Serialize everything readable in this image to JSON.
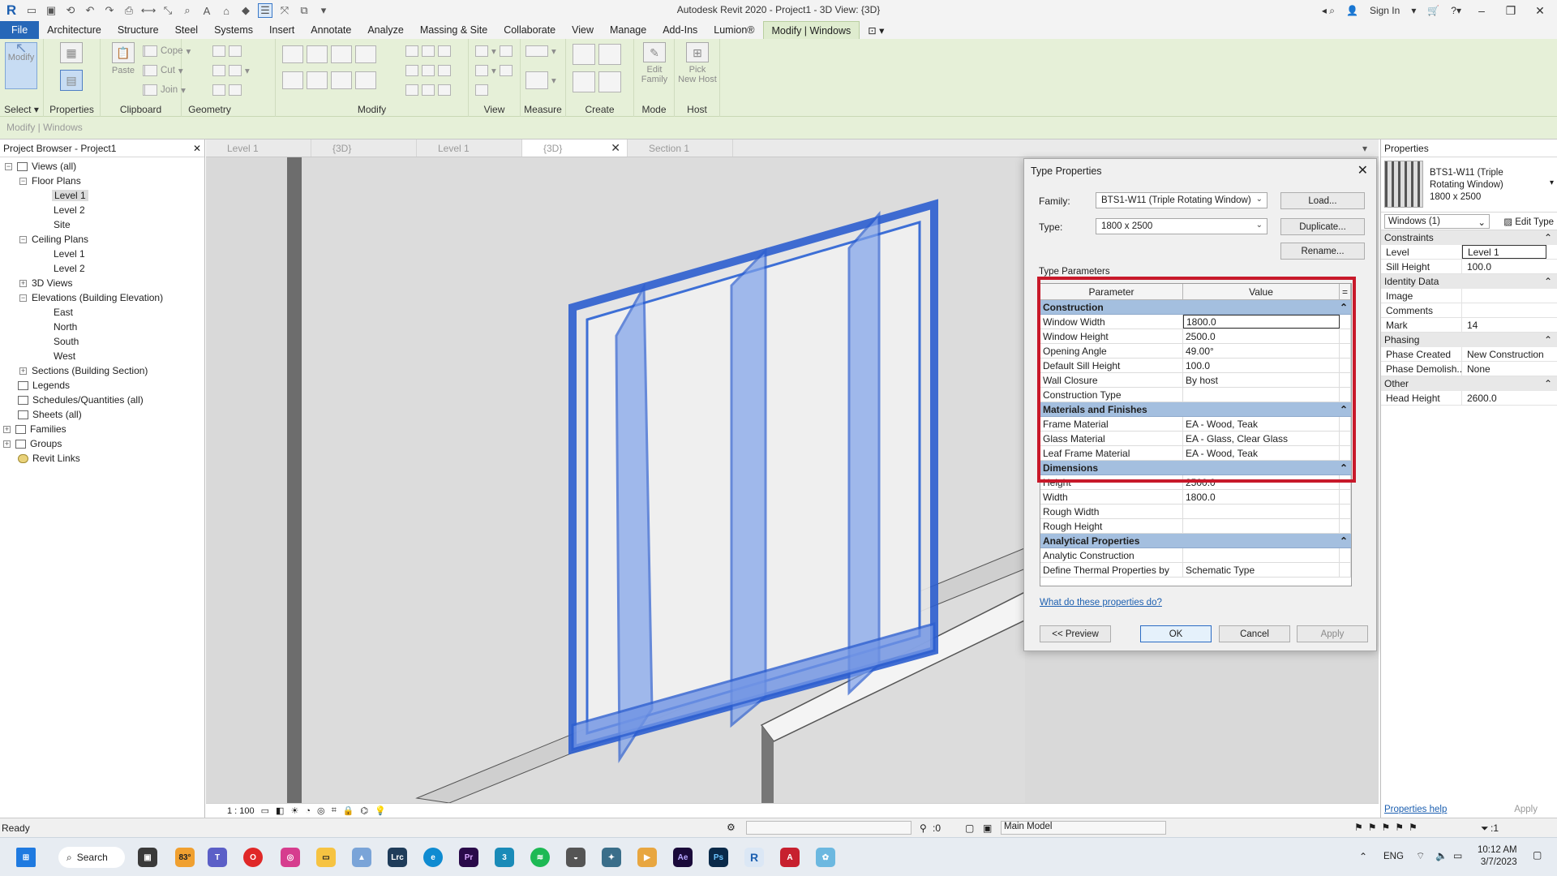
{
  "app": {
    "title": "Autodesk Revit 2020 - Project1 - 3D View: {3D}",
    "sign_in": "Sign In"
  },
  "ribbon": {
    "tabs": [
      "File",
      "Architecture",
      "Structure",
      "Steel",
      "Systems",
      "Insert",
      "Annotate",
      "Analyze",
      "Massing & Site",
      "Collaborate",
      "View",
      "Manage",
      "Add-Ins",
      "Lumion®",
      "Modify | Windows"
    ],
    "panels": {
      "select": "Select",
      "properties": "Properties",
      "clipboard": "Clipboard",
      "geometry": "Geometry",
      "modify": "Modify",
      "view": "View",
      "measure": "Measure",
      "create": "Create",
      "mode": "Mode",
      "host": "Host"
    },
    "buttons": {
      "modify": "Modify",
      "paste": "Paste",
      "cope": "Cope",
      "cut": "Cut",
      "join": "Join",
      "edit_family_1": "Edit",
      "edit_family_2": "Family",
      "pick_host_1": "Pick",
      "pick_host_2": "New Host"
    },
    "context": "Modify | Windows"
  },
  "project_browser": {
    "title": "Project Browser - Project1",
    "nodes": [
      {
        "label": "Views (all)"
      },
      {
        "label": "Floor Plans"
      },
      {
        "label": "Level 1"
      },
      {
        "label": "Level 2"
      },
      {
        "label": "Site"
      },
      {
        "label": "Ceiling Plans"
      },
      {
        "label": "Level 1"
      },
      {
        "label": "Level 2"
      },
      {
        "label": "3D Views"
      },
      {
        "label": "Elevations (Building Elevation)"
      },
      {
        "label": "East"
      },
      {
        "label": "North"
      },
      {
        "label": "South"
      },
      {
        "label": "West"
      },
      {
        "label": "Sections (Building Section)"
      },
      {
        "label": "Legends"
      },
      {
        "label": "Schedules/Quantities (all)"
      },
      {
        "label": "Sheets (all)"
      },
      {
        "label": "Families"
      },
      {
        "label": "Groups"
      },
      {
        "label": "Revit Links"
      }
    ]
  },
  "view_tabs": [
    "Level 1",
    "{3D}",
    "Level 1",
    "{3D}",
    "Section 1"
  ],
  "view_control": {
    "scale": "1 : 100"
  },
  "dialog": {
    "title": "Type Properties",
    "family_label": "Family:",
    "family_value": "BTS1-W11 (Triple Rotating Window)",
    "type_label": "Type:",
    "type_value": "1800 x 2500",
    "load": "Load...",
    "duplicate": "Duplicate...",
    "rename": "Rename...",
    "type_params_label": "Type Parameters",
    "col_param": "Parameter",
    "col_value": "Value",
    "col_eq": "=",
    "sections": [
      {
        "name": "Construction",
        "rows": [
          {
            "p": "Window Width",
            "v": "1800.0"
          },
          {
            "p": "Window Height",
            "v": "2500.0"
          },
          {
            "p": "Opening Angle",
            "v": "49.00°"
          },
          {
            "p": "Default Sill Height",
            "v": "100.0"
          },
          {
            "p": "Wall Closure",
            "v": "By host"
          },
          {
            "p": "Construction Type",
            "v": ""
          }
        ]
      },
      {
        "name": "Materials and Finishes",
        "rows": [
          {
            "p": "Frame Material",
            "v": "EA - Wood, Teak"
          },
          {
            "p": "Glass Material",
            "v": "EA - Glass, Clear Glass"
          },
          {
            "p": "Leaf Frame Material",
            "v": "EA - Wood, Teak"
          }
        ]
      },
      {
        "name": "Dimensions",
        "rows": [
          {
            "p": "Height",
            "v": "2500.0"
          },
          {
            "p": "Width",
            "v": "1800.0"
          },
          {
            "p": "Rough Width",
            "v": ""
          },
          {
            "p": "Rough Height",
            "v": ""
          }
        ]
      },
      {
        "name": "Analytical Properties",
        "rows": [
          {
            "p": "Analytic Construction",
            "v": ""
          },
          {
            "p": "Define Thermal Properties by",
            "v": "Schematic Type"
          }
        ]
      }
    ],
    "help_link": "What do these properties do?",
    "preview": "<< Preview",
    "ok": "OK",
    "cancel": "Cancel",
    "apply": "Apply"
  },
  "properties": {
    "title": "Properties",
    "type_name_1": "BTS1-W11 (Triple",
    "type_name_2": "Rotating Window)",
    "type_name_3": "1800 x 2500",
    "selector": "Windows (1)",
    "edit_type": "Edit Type",
    "sections": [
      {
        "name": "Constraints",
        "rows": [
          {
            "p": "Level",
            "v": "Level 1"
          },
          {
            "p": "Sill Height",
            "v": "100.0"
          }
        ]
      },
      {
        "name": "Identity Data",
        "rows": [
          {
            "p": "Image",
            "v": ""
          },
          {
            "p": "Comments",
            "v": ""
          },
          {
            "p": "Mark",
            "v": "14"
          }
        ]
      },
      {
        "name": "Phasing",
        "rows": [
          {
            "p": "Phase Created",
            "v": "New Construction"
          },
          {
            "p": "Phase Demolish...",
            "v": "None"
          }
        ]
      },
      {
        "name": "Other",
        "rows": [
          {
            "p": "Head Height",
            "v": "2600.0"
          }
        ]
      }
    ],
    "help": "Properties help",
    "apply": "Apply"
  },
  "status": {
    "text": "Ready",
    "coord": ":0",
    "model": "Main Model",
    "filter": ":1"
  },
  "taskbar": {
    "search": "Search",
    "weather": "83°",
    "lang": "ENG",
    "time": "10:12 AM",
    "date": "3/7/2023"
  },
  "colors": {
    "accent": "#2667b8",
    "ribbon": "#e6f0d8",
    "highlight_box": "#c8192a",
    "section_header": "#a4bfdf",
    "window_blue": "#3d6fd6"
  }
}
